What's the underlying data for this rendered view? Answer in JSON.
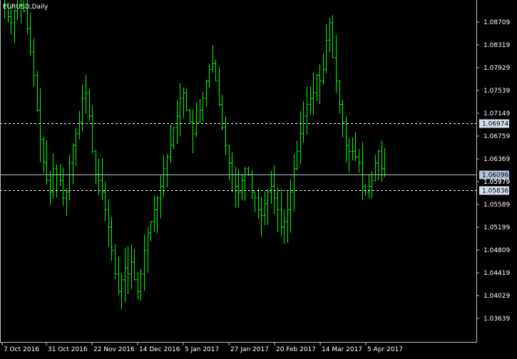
{
  "window": {
    "symbol_label": "EURUSD,Daily"
  },
  "colors": {
    "background": "#000000",
    "frame": "#c0c0c0",
    "text": "#ffffff",
    "bar": "#00ff00",
    "level_line": "#ffffff",
    "current_line": "#b0c4de",
    "level_badge": "#d3dfee",
    "current_badge": "#b0c4de"
  },
  "chart_data": {
    "type": "ohlc",
    "title": "EURUSD,Daily",
    "price_axis": {
      "ticks": [
        "1.08709",
        "1.08319",
        "1.07929",
        "1.07539",
        "1.07149",
        "1.06759",
        "1.06369",
        "1.05979",
        "1.05589",
        "1.05199",
        "1.04809",
        "1.04419",
        "1.04029",
        "1.03639"
      ],
      "range": [
        1.0324,
        1.0906
      ]
    },
    "time_axis": {
      "labels": [
        "7 Oct 2016",
        "31 Oct 2016",
        "22 Nov 2016",
        "14 Dec 2016",
        "5 Jan 2017",
        "27 Jan 2017",
        "20 Feb 2017",
        "14 Mar 2017",
        "5 Apr 2017"
      ]
    },
    "levels": [
      {
        "name": "upper-level",
        "value": 1.06974,
        "label": "1.06974",
        "style": "dashed"
      },
      {
        "name": "lower-level",
        "value": 1.05836,
        "label": "1.05836",
        "style": "dashed"
      }
    ],
    "current_price": {
      "value": 1.06096,
      "label": "1.06096"
    },
    "hidden_tick_partial": "1.05979",
    "closes": [
      1.09,
      1.088,
      1.087,
      1.089,
      1.09,
      1.091,
      1.089,
      1.086,
      1.082,
      1.078,
      1.072,
      1.067,
      1.063,
      1.06,
      1.058,
      1.062,
      1.061,
      1.06,
      1.057,
      1.058,
      1.063,
      1.066,
      1.068,
      1.07,
      1.074,
      1.075,
      1.071,
      1.065,
      1.061,
      1.06,
      1.058,
      1.055,
      1.052,
      1.048,
      1.044,
      1.041,
      1.043,
      1.045,
      1.044,
      1.046,
      1.043,
      1.041,
      1.044,
      1.048,
      1.051,
      1.053,
      1.055,
      1.057,
      1.059,
      1.062,
      1.064,
      1.066,
      1.069,
      1.071,
      1.074,
      1.075,
      1.072,
      1.07,
      1.068,
      1.07,
      1.072,
      1.074,
      1.077,
      1.079,
      1.08,
      1.077,
      1.073,
      1.069,
      1.066,
      1.063,
      1.061,
      1.059,
      1.058,
      1.06,
      1.062,
      1.061,
      1.058,
      1.057,
      1.055,
      1.054,
      1.056,
      1.058,
      1.059,
      1.057,
      1.055,
      1.052,
      1.053,
      1.055,
      1.058,
      1.062,
      1.065,
      1.068,
      1.071,
      1.073,
      1.074,
      1.075,
      1.078,
      1.077,
      1.079,
      1.084,
      1.087,
      1.081,
      1.077,
      1.073,
      1.07,
      1.066,
      1.065,
      1.065,
      1.064,
      1.063,
      1.059,
      1.058,
      1.059,
      1.06,
      1.063,
      1.065,
      1.062,
      1.061
    ]
  }
}
